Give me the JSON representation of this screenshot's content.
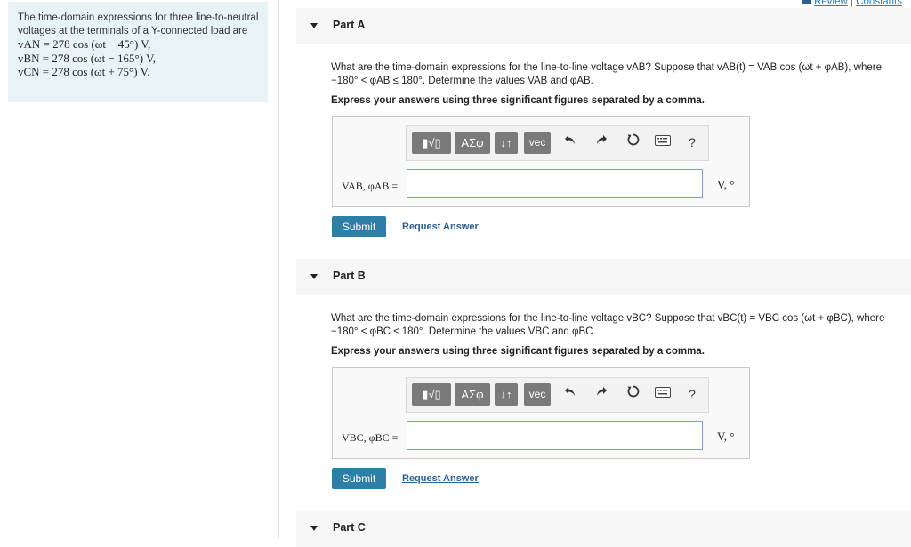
{
  "header": {
    "review": "Review",
    "sep": "|",
    "constants": "Constants"
  },
  "info": {
    "intro": "The time-domain expressions for three line-to-neutral voltages at the terminals of a Y-connected load are",
    "eq1": "vAN = 278 cos (ωt − 45°) V,",
    "eq2": "vBN = 278 cos (ωt − 165°) V,",
    "eq3": "vCN = 278 cos (ωt + 75°) V."
  },
  "toolbar": {
    "templates": "▮√▯",
    "greek": "ΑΣφ",
    "arrows": "↓↑",
    "vec": "vec",
    "help": "?"
  },
  "parts": [
    {
      "title": "Part A",
      "question_line1": "What are the time-domain expressions for the line-to-line voltage vAB? Suppose that vAB(t) = VAB cos (ωt + φAB), where",
      "question_line2": "−180° < φAB ≤ 180°. Determine the values VAB and φAB.",
      "instruction": "Express your answers using three significant figures separated by a comma.",
      "answer_label": "VAB, φAB =",
      "answer_value": "",
      "unit": "V, °",
      "submit": "Submit",
      "request": "Request Answer"
    },
    {
      "title": "Part B",
      "question_line1": "What are the time-domain expressions for the line-to-line voltage vBC? Suppose that vBC(t) = VBC cos (ωt + φBC), where",
      "question_line2": "−180° < φBC ≤ 180°. Determine the values VBC and φBC.",
      "instruction": "Express your answers using three significant figures separated by a comma.",
      "answer_label": "VBC, φBC =",
      "answer_value": "",
      "unit": "V, °",
      "submit": "Submit",
      "request": "Request Answer"
    },
    {
      "title": "Part C"
    }
  ]
}
